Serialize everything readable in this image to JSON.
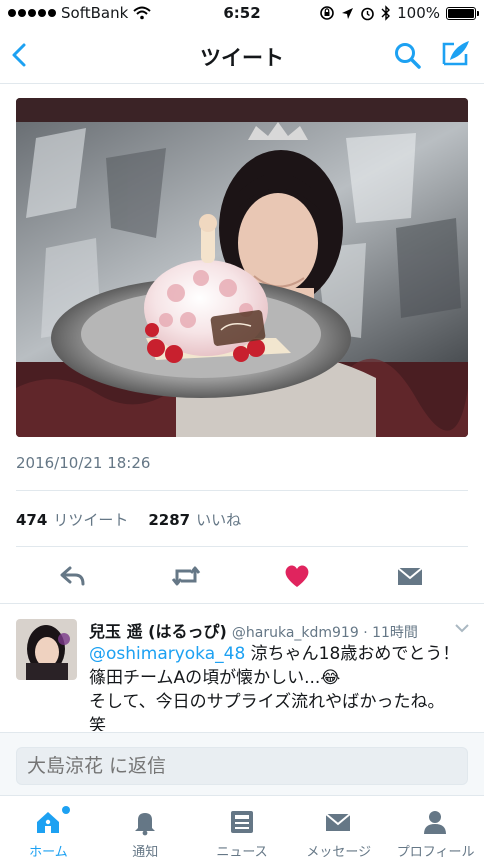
{
  "status": {
    "carrier": "SoftBank",
    "time": "6:52",
    "battery": "100%",
    "battery_level": 1.0
  },
  "nav": {
    "title": "ツイート"
  },
  "tweet": {
    "date": "2016/10/21 18:26",
    "retweet_count": "474",
    "retweet_label": "リツイート",
    "like_count": "2287",
    "like_label": "いいね",
    "liked": true
  },
  "reply": {
    "name": "兒玉 遥 (はるっぴ)",
    "handle": "@haruka_kdm919 · 11時間",
    "mention": "@oshimaryoka_48",
    "line1_rest": " 涼ちゃん18歳おめでとう！",
    "line2": "篠田チームAの頃が懐かしい...😂",
    "line3": "そして、今日のサプライズ流れやばかったね。",
    "line4": "笑"
  },
  "compose": {
    "placeholder": "大島涼花 に返信"
  },
  "tabs": [
    {
      "label": "ホーム",
      "icon": "home-icon",
      "active": true
    },
    {
      "label": "通知",
      "icon": "bell-icon",
      "active": false
    },
    {
      "label": "ニュース",
      "icon": "news-icon",
      "active": false
    },
    {
      "label": "メッセージ",
      "icon": "envelope-icon",
      "active": false
    },
    {
      "label": "プロフィール",
      "icon": "profile-icon",
      "active": false
    }
  ],
  "colors": {
    "accent": "#1da1f2",
    "like": "#e0245e",
    "muted": "#657786"
  }
}
